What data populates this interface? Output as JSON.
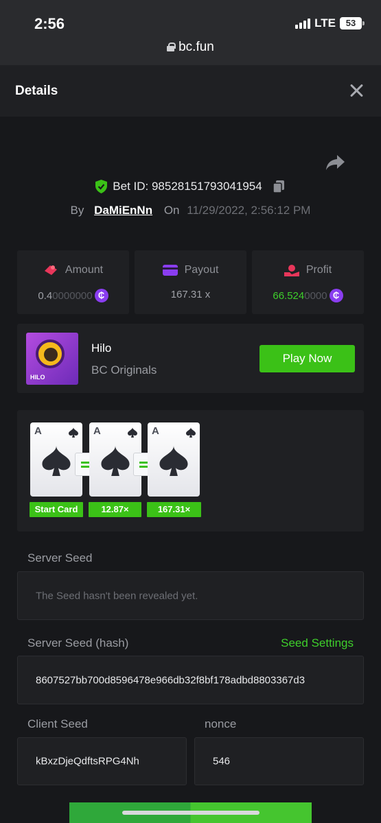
{
  "status_bar": {
    "time": "2:56",
    "network": "LTE",
    "battery": "53"
  },
  "browser": {
    "url": "bc.fun"
  },
  "header": {
    "title": "Details"
  },
  "bet": {
    "id_label": "Bet ID: 98528151793041954",
    "by_label": "By",
    "username": "DaMiEnNn",
    "on_label": "On",
    "date": "11/29/2022, 2:56:12 PM"
  },
  "stats": {
    "amount": {
      "label": "Amount",
      "value_main": "0.4",
      "value_dim": "0000000"
    },
    "payout": {
      "label": "Payout",
      "value": "167.31 x"
    },
    "profit": {
      "label": "Profit",
      "value_main": "66.524",
      "value_dim": "0000"
    },
    "coin_symbol": "₵"
  },
  "game": {
    "name": "Hilo",
    "provider": "BC Originals",
    "thumb_label": "HILO",
    "play_label": "Play Now"
  },
  "cards": [
    {
      "rank": "A",
      "label": "Start Card"
    },
    {
      "rank": "A",
      "label": "12.87×"
    },
    {
      "rank": "A",
      "label": "167.31×"
    }
  ],
  "seeds": {
    "server_seed_label": "Server Seed",
    "server_seed_value": "The Seed hasn't been revealed yet.",
    "server_hash_label": "Server Seed (hash)",
    "seed_settings_label": "Seed Settings",
    "server_hash_value": "8607527bb700d8596478e966db32f8bf178adbd8803367d3",
    "client_seed_label": "Client Seed",
    "client_seed_value": "kBxzDjeQdftsRPG4Nh",
    "nonce_label": "nonce",
    "nonce_value": "546"
  },
  "colors": {
    "accent_green": "#3bc117",
    "coin_purple": "#8a3df0",
    "panel": "#1f2023",
    "background": "#17181b"
  }
}
